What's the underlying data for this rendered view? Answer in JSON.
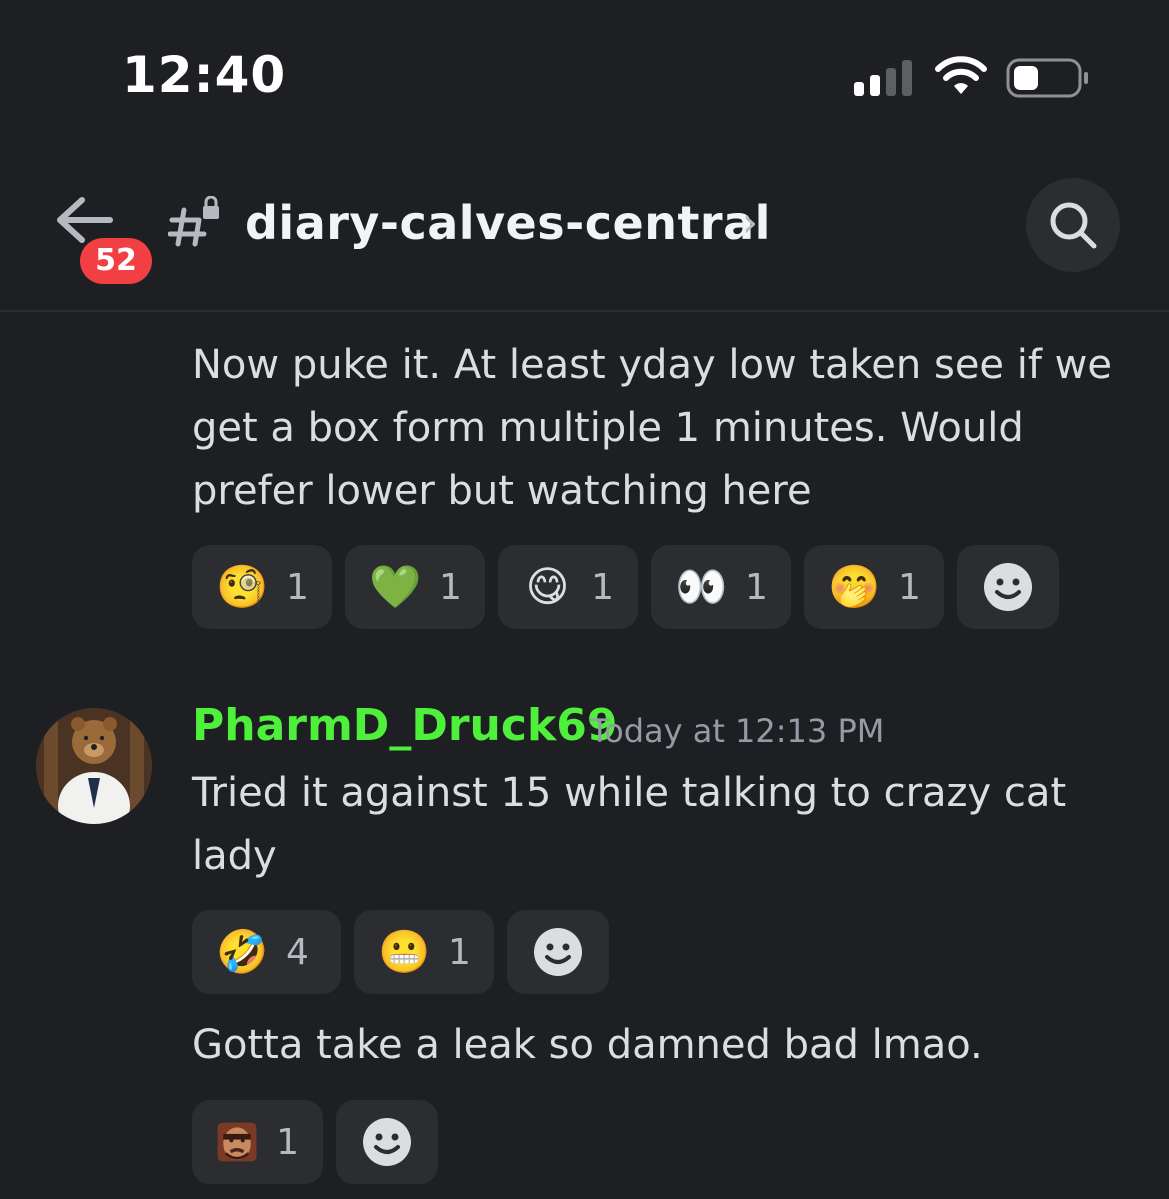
{
  "status_bar": {
    "time": "12:40"
  },
  "header": {
    "badge_count": "52",
    "channel_name": "diary-calves-central",
    "chevron": "›"
  },
  "messages": [
    {
      "text": "Now puke it. At least yday low taken see if we get a box form multiple 1 minutes. Would prefer lower but watching here",
      "reactions": [
        {
          "emoji": "🧐",
          "icon": "face-with-monocle-icon",
          "count": "1"
        },
        {
          "emoji": "💚",
          "icon": "green-heart-icon",
          "count": "1"
        },
        {
          "emoji": "😋",
          "icon": "yum-face-icon",
          "count": "1"
        },
        {
          "emoji": "👀",
          "icon": "eyes-icon",
          "count": "1"
        },
        {
          "emoji": "🤭",
          "icon": "hand-over-mouth-icon",
          "count": "1"
        }
      ]
    },
    {
      "author": "PharmD_Druck69",
      "timestamp": "Today at 12:13 PM",
      "text": "Tried it against 15 while talking to crazy cat lady",
      "reactions": [
        {
          "emoji": "🤣",
          "icon": "rofl-icon",
          "count": "4"
        },
        {
          "emoji": "😬",
          "icon": "grimacing-icon",
          "count": "1"
        }
      ]
    },
    {
      "text": "Gotta take a leak so damned bad lmao.",
      "reactions": [
        {
          "emoji": "",
          "icon": "custom-face-emoji-icon",
          "count": "1"
        }
      ]
    }
  ],
  "colors": {
    "background": "#1e1f22",
    "username": "#4ef03c",
    "badge": "#f23f43",
    "reaction_bg": "#2b2d31"
  }
}
